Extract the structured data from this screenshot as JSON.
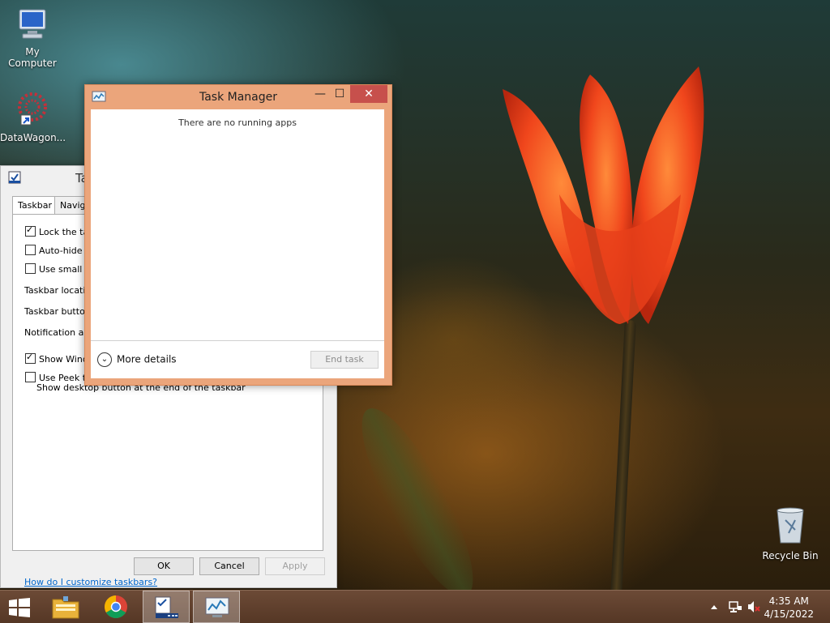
{
  "desktop": {
    "icons": [
      {
        "label": "My Computer"
      },
      {
        "label": "DataWagon..."
      },
      {
        "label": "Recycle Bin"
      }
    ]
  },
  "taskbar_properties": {
    "title_partial": "Ta",
    "tabs": [
      "Taskbar",
      "Naviga"
    ],
    "options": [
      {
        "label": "Lock the task",
        "checked": true
      },
      {
        "label": "Auto-hide th",
        "checked": false
      },
      {
        "label": "Use small tas",
        "checked": false
      }
    ],
    "labels": [
      "Taskbar location",
      "Taskbar buttons",
      "Notification area"
    ],
    "show_windows": {
      "label": "Show Windo",
      "checked": true
    },
    "use_peek": {
      "label": "Use Peek to",
      "sub": "Show desktop button at the end of the taskbar",
      "checked": false
    },
    "help_link": "How do I customize taskbars?",
    "buttons": {
      "ok": "OK",
      "cancel": "Cancel",
      "apply": "Apply"
    }
  },
  "task_manager": {
    "title": "Task Manager",
    "message": "There are no running apps",
    "more_details": "More details",
    "end_task": "End task",
    "controls": {
      "minimize": "—",
      "maximize": "☐",
      "close": "✕"
    }
  },
  "tray": {
    "time": "4:35 AM",
    "date": "4/15/2022"
  },
  "colors": {
    "task_manager_frame": "#eba57b",
    "close_button": "#c7504c",
    "taskbar": "#5e3f2c"
  }
}
